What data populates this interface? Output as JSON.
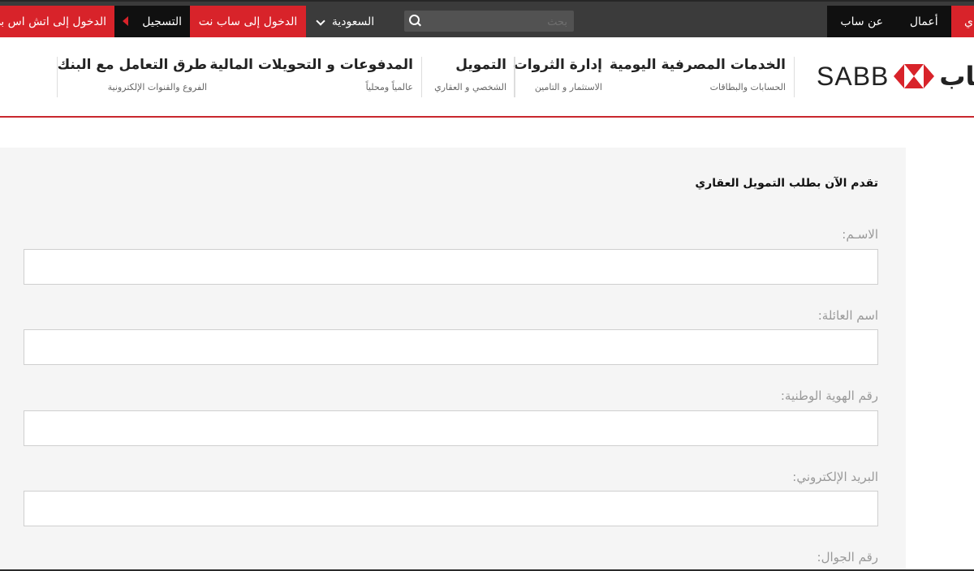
{
  "topbar": {
    "login_hsbc": "الدخول إلى اتش اس بي",
    "register": "التسجيل",
    "login_sabbnet": "الدخول إلى ساب نت",
    "country": "السعودية",
    "search_placeholder": "بحث",
    "about": "عن ساب",
    "business": "أعمال",
    "personal": "ي"
  },
  "header": {
    "logo_latin": "SABB",
    "logo_arabic": "ساب",
    "nav": [
      {
        "title": "الخدمات المصرفية اليومية",
        "sub": "الحسابات والبطاقات"
      },
      {
        "title": "إدارة الثروات",
        "sub": "الاستثمار و التامين"
      },
      {
        "title": "التمويل",
        "sub": "الشخصي و العقاري"
      },
      {
        "title": "المدفوعات و التحويلات المالية",
        "sub": "عالمياً ومحلياً"
      },
      {
        "title": "طرق التعامل مع البنك",
        "sub": "الفروع والقنوات الإلكترونية"
      }
    ]
  },
  "form": {
    "title": "تقدم الآن بطلب التمويل العقاري",
    "fields": [
      {
        "label": "الاسـم:",
        "value": ""
      },
      {
        "label": "اسم العائلة:",
        "value": ""
      },
      {
        "label": "رقم الهوية الوطنية:",
        "value": ""
      },
      {
        "label": "البريد الإلكتروني:",
        "value": ""
      },
      {
        "label": "رقم الجوال:",
        "value": ""
      }
    ]
  },
  "colors": {
    "brand_red": "#d8232a",
    "topbar": "#3b3b3b",
    "panel": "#f5f5f5"
  }
}
